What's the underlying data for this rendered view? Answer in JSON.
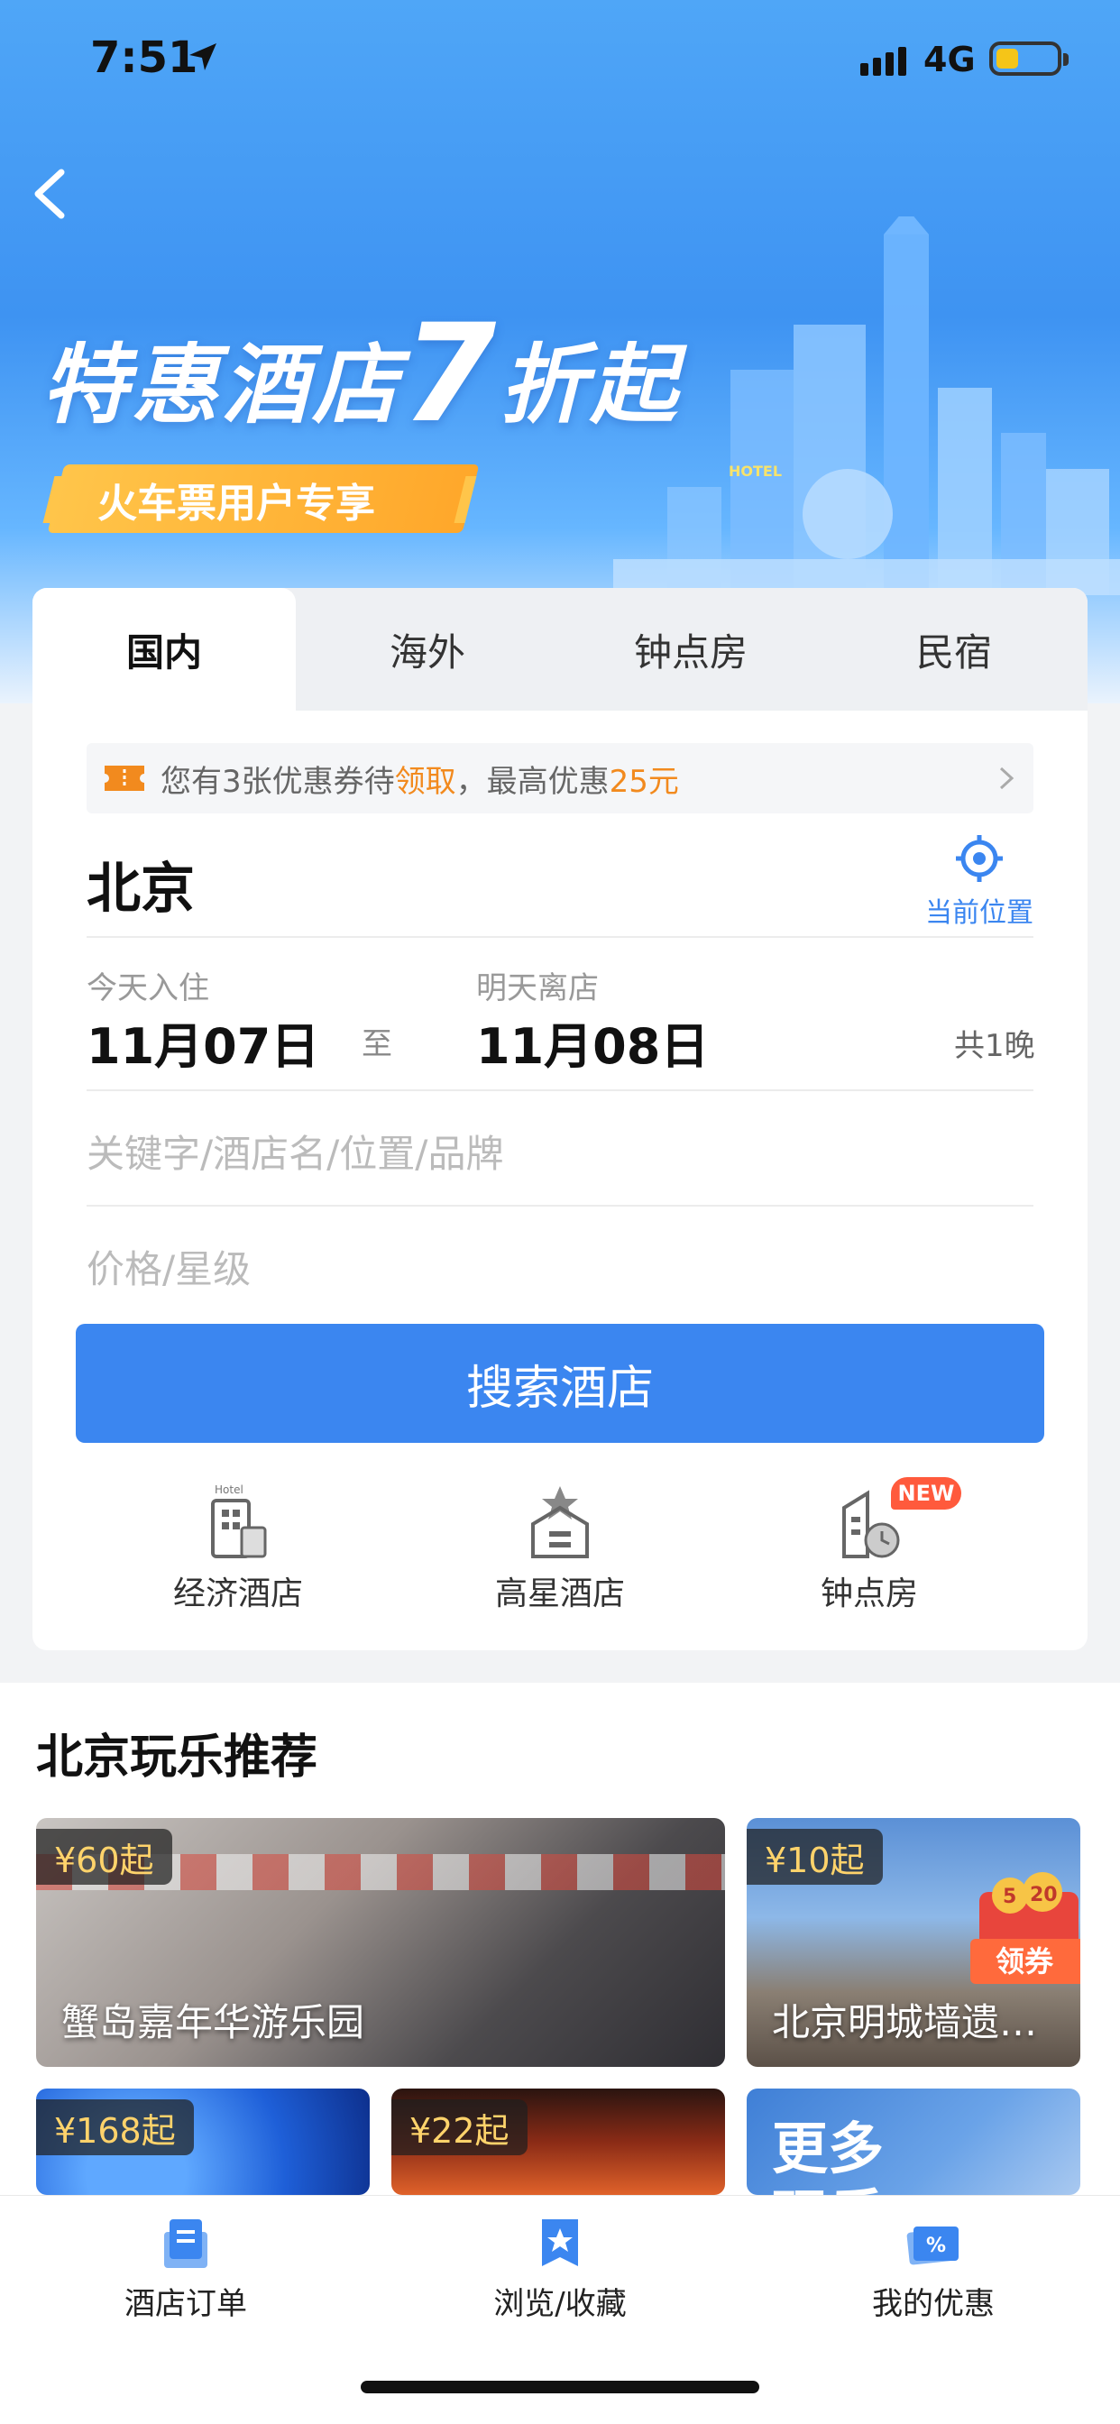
{
  "status_bar": {
    "time": "7:51",
    "network": "4G"
  },
  "hero": {
    "title_pre": "特惠酒店",
    "title_num": "7",
    "title_post": "折起",
    "pill": "火车票用户专享",
    "city_sign": "HOTEL"
  },
  "tabs": [
    "国内",
    "海外",
    "钟点房",
    "民宿"
  ],
  "coupon": {
    "t1": "您有3张优惠券待",
    "t2": "领取",
    "t3": "，最高优惠",
    "t4": "25元"
  },
  "destination": {
    "city": "北京",
    "locate_label": "当前位置"
  },
  "dates": {
    "checkin_label": "今天入住",
    "checkin": "11月07日",
    "to": "至",
    "checkout_label": "明天离店",
    "checkout": "11月08日",
    "nights": "共1晚"
  },
  "fields": {
    "keyword_placeholder": "关键字/酒店名/位置/品牌",
    "price_placeholder": "价格/星级"
  },
  "search_button": "搜索酒店",
  "quick_links": [
    {
      "label": "经济酒店",
      "icon": "budget-hotel-icon",
      "icon_text": "Hotel"
    },
    {
      "label": "高星酒店",
      "icon": "star-hotel-icon"
    },
    {
      "label": "钟点房",
      "icon": "hourly-room-icon",
      "badge": "NEW"
    }
  ],
  "recommend": {
    "title": "北京玩乐推荐",
    "tiles": [
      {
        "price": "¥60起",
        "name": "蟹岛嘉年华游乐园"
      },
      {
        "price": "¥10起",
        "name": "北京明城墙遗…",
        "badge": "领券",
        "badge_numbers": [
          "5",
          "20"
        ]
      },
      {
        "price": "¥168起",
        "name": ""
      },
      {
        "price": "¥22起",
        "name": ""
      },
      {
        "more": "更多\n玩乐"
      }
    ]
  },
  "bottom_nav": [
    {
      "label": "酒店订单",
      "icon": "order-icon"
    },
    {
      "label": "浏览/收藏",
      "icon": "favorite-icon"
    },
    {
      "label": "我的优惠",
      "icon": "discount-icon"
    }
  ],
  "colors": {
    "primary": "#3b86f0",
    "accent": "#f28a1e",
    "promo": "#ffb238"
  }
}
